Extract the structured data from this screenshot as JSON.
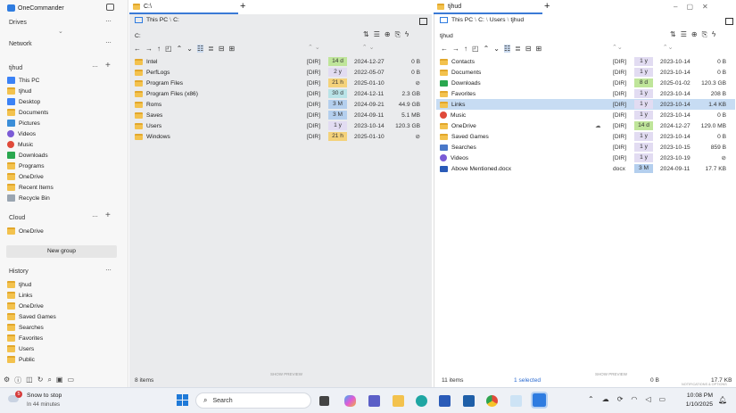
{
  "app": {
    "title": "OneCommander"
  },
  "sidebar": {
    "drives_label": "Drives",
    "network_label": "Network",
    "user_label": "tjhud",
    "user_items": [
      {
        "label": "This PC",
        "icon": "monitor-icon"
      },
      {
        "label": "tjhud",
        "icon": "folder-icon"
      },
      {
        "label": "Desktop",
        "icon": "desktop-icon"
      },
      {
        "label": "Documents",
        "icon": "folder-icon"
      },
      {
        "label": "Pictures",
        "icon": "pictures-icon"
      },
      {
        "label": "Videos",
        "icon": "videos-icon"
      },
      {
        "label": "Music",
        "icon": "music-icon"
      },
      {
        "label": "Downloads",
        "icon": "download-icon"
      },
      {
        "label": "Programs",
        "icon": "folder-icon"
      },
      {
        "label": "OneDrive",
        "icon": "folder-icon"
      },
      {
        "label": "Recent Items",
        "icon": "folder-icon"
      },
      {
        "label": "Recycle Bin",
        "icon": "recycle-bin-icon"
      }
    ],
    "cloud_label": "Cloud",
    "cloud_items": [
      {
        "label": "OneDrive"
      }
    ],
    "new_group_label": "New group",
    "history_label": "History",
    "history_items": [
      {
        "label": "tjhud"
      },
      {
        "label": "Links"
      },
      {
        "label": "OneDrive"
      },
      {
        "label": "Saved Games"
      },
      {
        "label": "Searches"
      },
      {
        "label": "Favorites"
      },
      {
        "label": "Users"
      },
      {
        "label": "Public"
      }
    ]
  },
  "left_pane": {
    "tab_label": "C:\\",
    "crumbs": [
      "This PC",
      "C:"
    ],
    "path": "C:",
    "rows": [
      {
        "name": "Intel",
        "type": "[DIR]",
        "age": "14 d",
        "age_color": "#bfe59a",
        "date": "2024-12-27",
        "size": "0 B"
      },
      {
        "name": "PerfLogs",
        "type": "[DIR]",
        "age": "2 y",
        "age_color": "#e2dcf2",
        "date": "2022-05-07",
        "size": "0 B"
      },
      {
        "name": "Program Files",
        "type": "[DIR]",
        "age": "21 h",
        "age_color": "#f4d27a",
        "date": "2025-01-10",
        "size": "⊘"
      },
      {
        "name": "Program Files (x86)",
        "type": "[DIR]",
        "age": "30 d",
        "age_color": "#b9e3e7",
        "date": "2024-12-11",
        "size": "2.3 GB"
      },
      {
        "name": "Roms",
        "type": "[DIR]",
        "age": "3 M",
        "age_color": "#b4cfee",
        "date": "2024-09-21",
        "size": "44.9 GB"
      },
      {
        "name": "Saves",
        "type": "[DIR]",
        "age": "3 M",
        "age_color": "#b4cfee",
        "date": "2024-09-11",
        "size": "5.1 MB"
      },
      {
        "name": "Users",
        "type": "[DIR]",
        "age": "1 y",
        "age_color": "#e2dcf2",
        "date": "2023-10-14",
        "size": "120.3 GB"
      },
      {
        "name": "Windows",
        "type": "[DIR]",
        "age": "21 h",
        "age_color": "#f4d27a",
        "date": "2025-01-10",
        "size": "⊘"
      }
    ],
    "status_count": "8 items",
    "show_preview": "SHOW PREVIEW"
  },
  "right_pane": {
    "tab_label": "tjhud",
    "crumbs": [
      "This PC",
      "C:",
      "Users",
      "tjhud"
    ],
    "path": "tjhud",
    "rows": [
      {
        "name": "Contacts",
        "icon": "contacts-icon",
        "type": "[DIR]",
        "age": "1 y",
        "age_color": "#e2dcf2",
        "date": "2023-10-14",
        "size": "0 B"
      },
      {
        "name": "Documents",
        "icon": "documents-icon",
        "type": "[DIR]",
        "age": "1 y",
        "age_color": "#e2dcf2",
        "date": "2023-10-14",
        "size": "0 B"
      },
      {
        "name": "Downloads",
        "icon": "download-icon",
        "type": "[DIR]",
        "age": "8 d",
        "age_color": "#bfe59a",
        "date": "2025-01-02",
        "size": "120.3 GB"
      },
      {
        "name": "Favorites",
        "icon": "folder-icon",
        "type": "[DIR]",
        "age": "1 y",
        "age_color": "#e2dcf2",
        "date": "2023-10-14",
        "size": "208 B"
      },
      {
        "name": "Links",
        "icon": "folder-icon",
        "type": "[DIR]",
        "age": "1 y",
        "age_color": "#e2dcf2",
        "date": "2023-10-14",
        "size": "1.4 KB",
        "selected": true
      },
      {
        "name": "Music",
        "icon": "music-icon",
        "type": "[DIR]",
        "age": "1 y",
        "age_color": "#e2dcf2",
        "date": "2023-10-14",
        "size": "0 B"
      },
      {
        "name": "OneDrive",
        "icon": "folder-icon",
        "type": "[DIR]",
        "age": "14 d",
        "age_color": "#bfe59a",
        "date": "2024-12-27",
        "size": "129.0 MB"
      },
      {
        "name": "Saved Games",
        "icon": "folder-icon",
        "type": "[DIR]",
        "age": "1 y",
        "age_color": "#e2dcf2",
        "date": "2023-10-14",
        "size": "0 B"
      },
      {
        "name": "Searches",
        "icon": "searches-icon",
        "type": "[DIR]",
        "age": "1 y",
        "age_color": "#e2dcf2",
        "date": "2023-10-15",
        "size": "859 B"
      },
      {
        "name": "Videos",
        "icon": "videos-icon",
        "type": "[DIR]",
        "age": "1 y",
        "age_color": "#e2dcf2",
        "date": "2023-10-19",
        "size": "⊘"
      },
      {
        "name": "Above Mentioned.docx",
        "icon": "word-doc-icon",
        "type": "docx",
        "age": "3 M",
        "age_color": "#b4cfee",
        "date": "2024-09-11",
        "size": "17.7 KB"
      }
    ],
    "status_count": "11 items",
    "status_selected": "1 selected",
    "status_size_a": "0 B",
    "status_size_b": "17.7 KB",
    "show_preview": "SHOW PREVIEW",
    "notice": "NOTIFICATIONS & OPTIONS"
  },
  "taskbar": {
    "weather_title": "Snow to stop",
    "weather_sub": "In 44 minutes",
    "weather_badge": "5",
    "search_placeholder": "Search",
    "time": "10:08 PM",
    "date": "1/10/2025"
  }
}
